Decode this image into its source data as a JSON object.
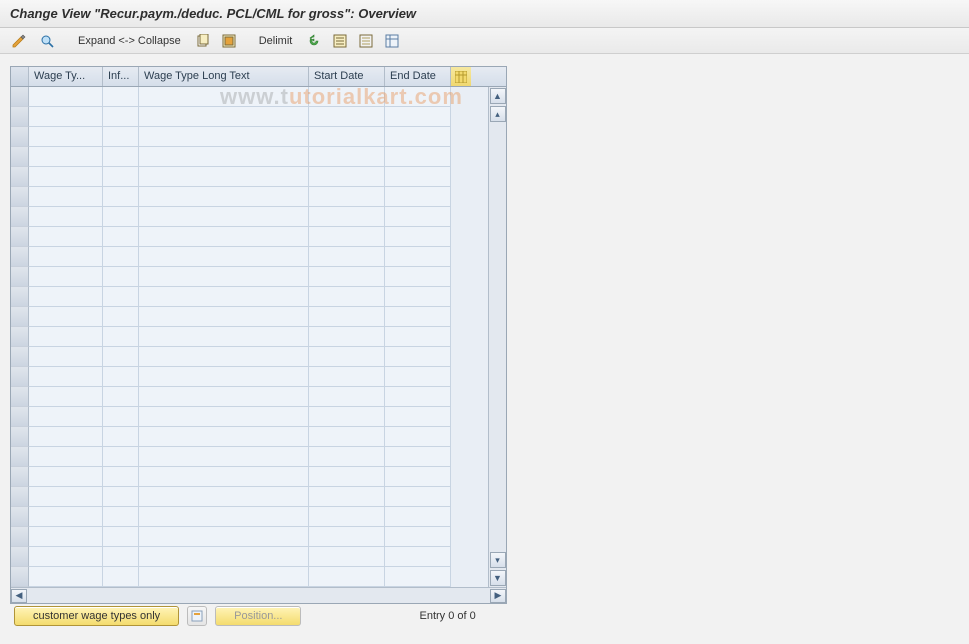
{
  "title": "Change View \"Recur.paym./deduc. PCL/CML for gross\": Overview",
  "toolbar": {
    "expand_collapse": "Expand <-> Collapse",
    "delimit": "Delimit"
  },
  "grid": {
    "columns": {
      "wage_type": "Wage Ty...",
      "infotype": "Inf...",
      "wage_long": "Wage Type Long Text",
      "start_date": "Start Date",
      "end_date": "End Date"
    },
    "rows": []
  },
  "footer": {
    "customer_btn": "customer wage types only",
    "position_btn": "Position...",
    "entry_text": "Entry 0 of 0"
  },
  "watermark": "www.tutorialkart.com"
}
